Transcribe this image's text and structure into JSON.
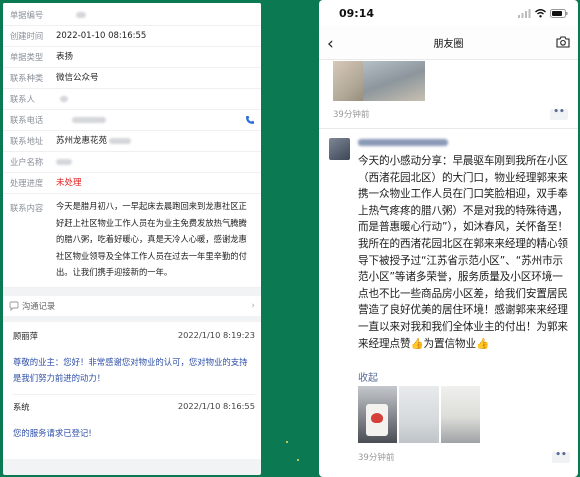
{
  "ticket": {
    "fields": [
      {
        "label": "单据编号",
        "value": ""
      },
      {
        "label": "创建时间",
        "value": "2022-01-10 08:16:55"
      },
      {
        "label": "单据类型",
        "value": "表扬"
      },
      {
        "label": "联系种类",
        "value": "微信公众号"
      },
      {
        "label": "联系人",
        "value": ""
      },
      {
        "label": "联系电话",
        "value": ""
      },
      {
        "label": "联系地址",
        "value": "苏州龙惠花苑"
      },
      {
        "label": "业户名称",
        "value": ""
      },
      {
        "label": "处理进度",
        "value": "未处理"
      }
    ],
    "content_label": "联系内容",
    "content_text": "今天是腊月初八，一早起床去晨跑回来到龙惠社区正好赶上社区物业工作人员在为业主免费发放热气腾腾的腊八粥，吃着好暖心，真是天冷人心暖，感谢龙惠社区物业领导及全体工作人员在过去一年里辛勤的付出。让我们携手迎接新的一年。",
    "status_color": "#e02020"
  },
  "communication": {
    "title": "沟通记录",
    "items": [
      {
        "author": "顾丽萍",
        "time": "2022/1/10 8:19:23",
        "message": "尊敬的业主：您好！非常感谢您对物业的认可，您对物业的支持是我们努力前进的动力！"
      },
      {
        "author": "系统",
        "time": "2022/1/10 8:16:55",
        "message": "您的服务请求已登记!"
      }
    ]
  },
  "moments": {
    "status_time": "09:14",
    "nav_title": "朋友圈",
    "back_label": "‹",
    "post1_time": "39分钟前",
    "post2_author": "",
    "post2_text": "今天的小感动分享：早晨驱车刚到我所在小区（西渚花园北区）的大门口，物业经理郭来来携一众物业工作人员在门口笑脸相迎，双手奉上热气疼疼的腊八粥）不是对我的特殊待遇，而是普惠暖心行动”），如沐春风，关怀备至！我所在的西渚花园北区在郭来来经理的精心领导下被授予过“江苏省示范小区”、“苏州市示范小区”等诸多荣誉，服务质量及小区环境一点也不比一些商品房小区差，给我们安置居民营造了良好优美的居住环境！感谢郭来来经理一直以来对我和我们全体业主的付出！为郭来来经理点赞👍为置信物业👍",
    "collapse_label": "收起",
    "post2_time": "39分钟前",
    "more_label": "••"
  },
  "icons": {
    "phone": "phone-icon",
    "chat": "chat-bubble-icon",
    "camera": "camera-icon",
    "signal": "signal-icon",
    "wifi": "wifi-icon",
    "battery": "battery-icon"
  },
  "colors": {
    "background": "#0b7a53",
    "link": "#576b95",
    "reply": "#2c4ea8"
  }
}
